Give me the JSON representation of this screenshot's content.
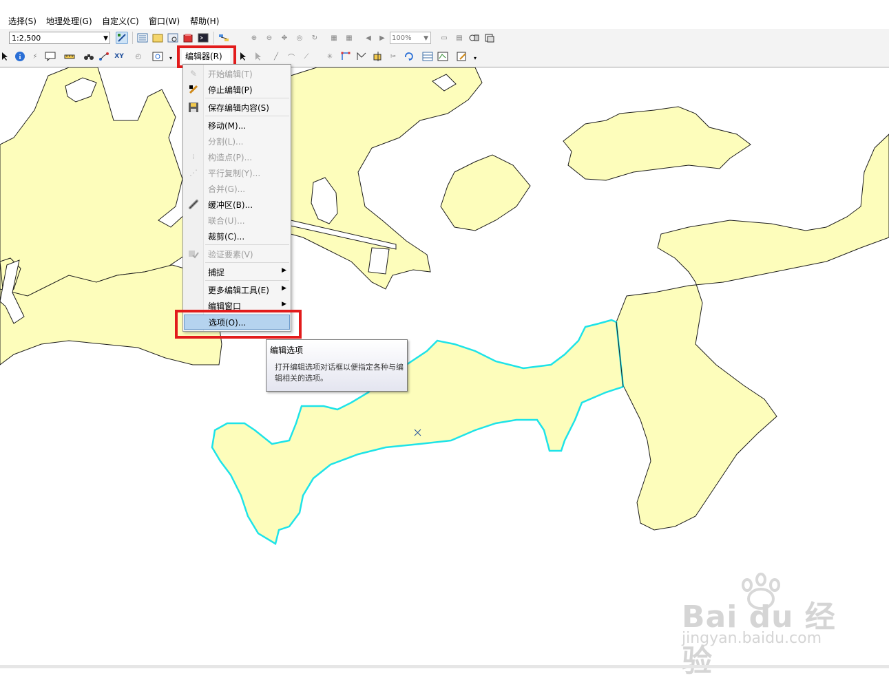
{
  "menubar": {
    "items": [
      "选择(S)",
      "地理处理(G)",
      "自定义(C)",
      "窗口(W)",
      "帮助(H)"
    ]
  },
  "toolbar": {
    "scale": "1:2,500",
    "zoom": "100%",
    "editor_label": "编辑器(R)"
  },
  "editor_menu": {
    "items": [
      {
        "label": "开始编辑(T)",
        "icon": "pencil-icon",
        "enabled": false
      },
      {
        "label": "停止编辑(P)",
        "icon": "stop-edit-icon",
        "enabled": true
      },
      {
        "label": "保存编辑内容(S)",
        "icon": "save-icon",
        "enabled": true
      },
      {
        "label": "移动(M)...",
        "icon": "",
        "enabled": true
      },
      {
        "label": "分割(L)...",
        "icon": "",
        "enabled": false
      },
      {
        "label": "构造点(P)...",
        "icon": "construct-points-icon",
        "enabled": false
      },
      {
        "label": "平行复制(Y)...",
        "icon": "copy-parallel-icon",
        "enabled": false
      },
      {
        "label": "合并(G)...",
        "icon": "",
        "enabled": false
      },
      {
        "label": "缓冲区(B)...",
        "icon": "buffer-icon",
        "enabled": true
      },
      {
        "label": "联合(U)...",
        "icon": "",
        "enabled": false
      },
      {
        "label": "裁剪(C)...",
        "icon": "",
        "enabled": true
      },
      {
        "label": "验证要素(V)",
        "icon": "validate-icon",
        "enabled": false
      },
      {
        "label": "捕捉",
        "icon": "",
        "enabled": true,
        "submenu": true
      },
      {
        "label": "更多编辑工具(E)",
        "icon": "",
        "enabled": true,
        "submenu": true
      },
      {
        "label": "编辑窗口",
        "icon": "",
        "enabled": true,
        "submenu": true
      },
      {
        "label": "选项(O)...",
        "icon": "",
        "enabled": true,
        "highlighted": true
      }
    ]
  },
  "tooltip": {
    "title": "编辑选项",
    "body": "打开编辑选项对话框以便指定各种与编辑相关的选项。"
  },
  "watermark": {
    "brand": "Bai du 经验",
    "url": "jingyan.baidu.com"
  },
  "colors": {
    "polygon_fill": "#fdfdbb",
    "selection_outline": "#1ee3e8",
    "highlight": "#e21b1b",
    "menu_highlight": "#b5d3ef"
  }
}
